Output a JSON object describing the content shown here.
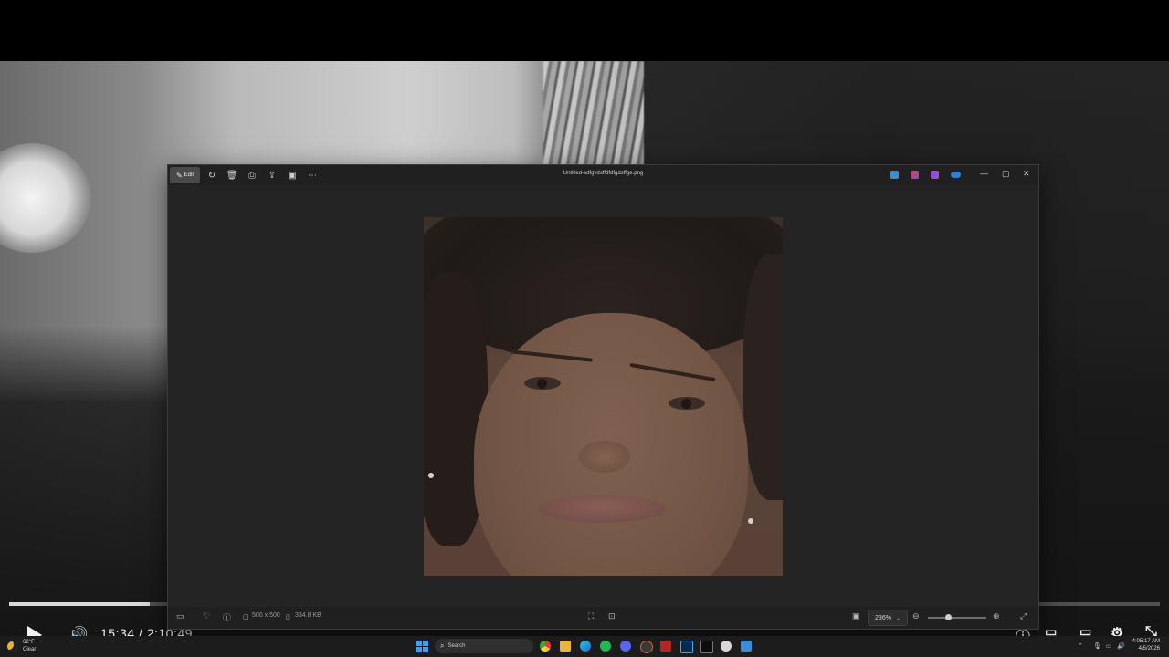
{
  "video": {
    "time_current": "15:34",
    "time_separator": "/",
    "time_total": "2:10:49",
    "progress_fraction": 0.122
  },
  "photos_app": {
    "edit_label": "Edit",
    "filename": "Untitled-sdfgvdsffdfdfgdsffge.png",
    "status": {
      "dimensions": "500 x 500",
      "file_size": "334.8 KB"
    },
    "zoom_value": "236%",
    "zoom_slider_fraction": 0.3
  },
  "taskbar": {
    "weather_temp": "62°F",
    "weather_condition": "Clear",
    "search_placeholder": "Search",
    "clock_time": "4:05:17 AM",
    "clock_date": "4/5/2026"
  },
  "colors": {
    "accent": "#3aa0ff",
    "moon": "#e5b33c"
  },
  "icons": {
    "edit": "edit-icon",
    "rotate": "rotate-icon",
    "delete": "trash-icon",
    "print": "print-icon",
    "share": "share-icon",
    "crop": "crop-icon",
    "more": "more-icon",
    "favorite": "heart-icon",
    "info": "info-icon"
  }
}
